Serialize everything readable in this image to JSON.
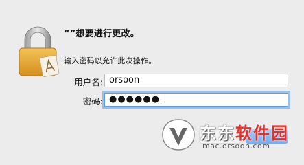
{
  "dialog": {
    "title": "“”想要进行更改。",
    "subtitle": "输入密码以允许此次操作。"
  },
  "form": {
    "username_label": "用户名:",
    "username_value": "orsoon",
    "password_label": "密码:",
    "password_mask": "●●●●●●"
  },
  "watermark": {
    "text_black": "东东",
    "text_red": "软件园",
    "url": "mac.orsoon.com"
  },
  "icons": {
    "lock": "lock-icon",
    "app_in_lock": "app-icon"
  },
  "colors": {
    "background": "#ececec",
    "focus_ring": "#5b9be8",
    "lock_gold": "#e3a93b",
    "watermark_red": "#e6312b"
  }
}
